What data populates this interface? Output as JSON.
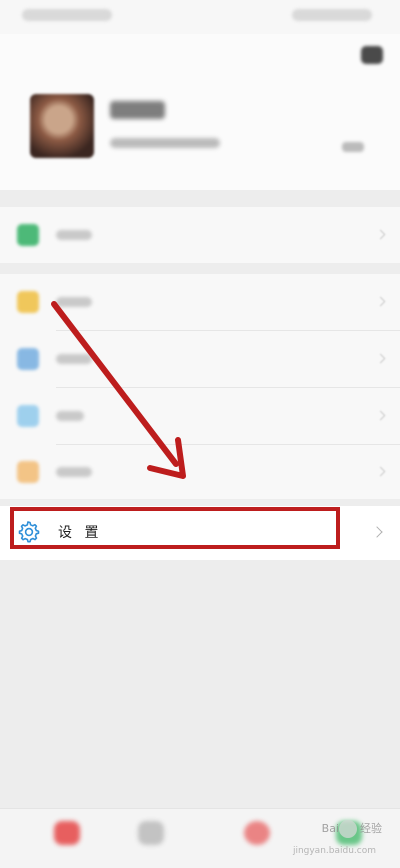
{
  "settings": {
    "label": "设 置"
  },
  "watermark": {
    "brand": "Bai",
    "suffix": "经验",
    "sub": "jingyan.baidu.com"
  },
  "colors": {
    "highlight": "#bd1d1d",
    "settings_icon": "#2f8fd8",
    "pay_icon": "#3bb36b",
    "fav_icon": "#f0c24b",
    "album_icon": "#3f8fd6",
    "cards_icon": "#47a9e4",
    "emoji_icon": "#f0a23c",
    "tab_chats": "#e43b3b",
    "tab_me": "#2fb35b"
  },
  "icons": [
    "camera-icon",
    "qr-code-icon",
    "pay-icon",
    "favorites-icon",
    "album-icon",
    "cards-icon",
    "emoji-icon",
    "settings-gear-icon",
    "chevron-right-icon"
  ]
}
